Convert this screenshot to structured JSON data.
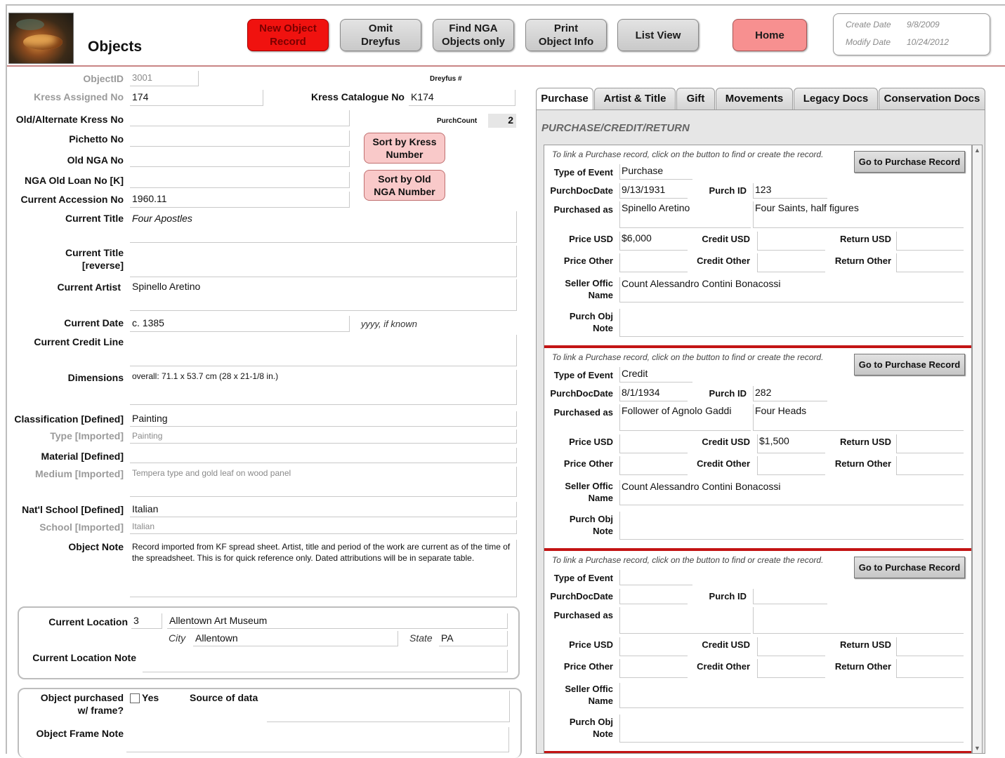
{
  "header": {
    "title": "Objects",
    "buttons": {
      "new_object": "New Object\nRecord",
      "omit_dreyfus": "Omit\nDreyfus",
      "find_nga": "Find NGA\nObjects only",
      "print": "Print\nObject Info",
      "list_view": "List View",
      "home": "Home"
    },
    "create_date_label": "Create Date",
    "create_date": "9/8/2009",
    "modify_date_label": "Modify Date",
    "modify_date": "10/24/2012"
  },
  "form": {
    "object_id_label": "ObjectID",
    "object_id": "3001",
    "dreyfus_label": "Dreyfus #",
    "kress_assigned_label": "Kress Assigned No",
    "kress_assigned": "174",
    "kress_catalogue_label": "Kress Catalogue No",
    "kress_catalogue": "K174",
    "old_alt_kress_label": "Old/Alternate Kress No",
    "old_alt_kress": "",
    "purch_count_label": "PurchCount",
    "purch_count": "2",
    "pichetto_label": "Pichetto No",
    "pichetto": "",
    "old_nga_label": "Old NGA No",
    "old_nga": "",
    "nga_old_loan_label": "NGA Old Loan No  [K]",
    "nga_old_loan": "",
    "current_accession_label": "Current Accession No",
    "current_accession": "1960.11",
    "sort_kress": "Sort by Kress\nNumber",
    "sort_old_nga": "Sort by Old\nNGA Number",
    "current_title_label": "Current Title",
    "current_title": "Four Apostles",
    "current_title_rev_label": "Current Title\n[reverse]",
    "current_title_rev": "",
    "current_artist_label": "Current Artist",
    "current_artist": "Spinello Aretino",
    "current_date_label": "Current Date",
    "current_date": "c. 1385",
    "date_hint": "yyyy, if known",
    "credit_line_label": "Current Credit Line",
    "credit_line": "",
    "dimensions_label": "Dimensions",
    "dimensions": "overall: 71.1 x 53.7 cm (28 x 21-1/8 in.)",
    "classification_label": "Classification [Defined]",
    "classification": "Painting",
    "type_label": "Type [Imported]",
    "type": "Painting",
    "material_label": "Material [Defined]",
    "material": "",
    "medium_label": "Medium [Imported]",
    "medium": "Tempera type and gold leaf on wood panel",
    "school_defined_label": "Nat'l School [Defined]",
    "school_defined": "Italian",
    "school_imported_label": "School [Imported]",
    "school_imported": "Italian",
    "object_note_label": "Object Note",
    "object_note": "Record imported from KF spread sheet. Artist, title and period of the work are current as of the time of the spreadsheet.  This is for quick reference only.  Dated attributions will be in separate table.",
    "location_label": "Current Location",
    "location_id": "3",
    "location_name": "Allentown Art Museum",
    "city_label": "City",
    "city": "Allentown",
    "state_label": "State",
    "state": "PA",
    "location_note_label": "Current Location Note",
    "location_note": "",
    "frame_label": "Object purchased\nw/ frame?",
    "frame_yes": "Yes",
    "source_label": "Source of data",
    "source": "",
    "frame_note_label": "Object Frame Note",
    "frame_note": ""
  },
  "tabs": [
    "Purchase",
    "Artist & Title",
    "Gift",
    "Movements",
    "Legacy Docs",
    "Conservation Docs"
  ],
  "purchase": {
    "section_title": "PURCHASE/CREDIT/RETURN",
    "link_hint": "To link a Purchase record, click on the button to find or create the record.",
    "go_button": "Go to Purchase Record",
    "labels": {
      "type_of_event": "Type of Event",
      "purch_doc_date": "PurchDocDate",
      "purch_id": "Purch ID",
      "purchased_as": "Purchased as",
      "price_usd": "Price USD",
      "credit_usd": "Credit USD",
      "return_usd": "Return USD",
      "price_other": "Price Other",
      "credit_other": "Credit Other",
      "return_other": "Return Other",
      "seller": "Seller Offic\nName",
      "purch_obj_note": "Purch Obj\nNote"
    },
    "records": [
      {
        "type_of_event": "Purchase",
        "purch_doc_date": "9/13/1931",
        "purch_id": "123",
        "purchased_as": "Spinello Aretino",
        "purchased_as_title": "Four Saints, half figures",
        "price_usd": "$6,000",
        "credit_usd": "",
        "return_usd": "",
        "price_other": "",
        "credit_other": "",
        "return_other": "",
        "seller": "Count Alessandro Contini Bonacossi",
        "note": ""
      },
      {
        "type_of_event": "Credit",
        "purch_doc_date": "8/1/1934",
        "purch_id": "282",
        "purchased_as": "Follower of Agnolo Gaddi",
        "purchased_as_title": "Four Heads",
        "price_usd": "",
        "credit_usd": "$1,500",
        "return_usd": "",
        "price_other": "",
        "credit_other": "",
        "return_other": "",
        "seller": "Count Alessandro Contini Bonacossi",
        "note": ""
      },
      {
        "type_of_event": "",
        "purch_doc_date": "",
        "purch_id": "",
        "purchased_as": "",
        "purchased_as_title": "",
        "price_usd": "",
        "credit_usd": "",
        "return_usd": "",
        "price_other": "",
        "credit_other": "",
        "return_other": "",
        "seller": "",
        "note": ""
      }
    ]
  },
  "icons": {
    "thumbnail": "painting-thumbnail-image",
    "scroll_up": "scroll-up-arrow-icon",
    "scroll_down": "scroll-down-arrow-icon"
  }
}
